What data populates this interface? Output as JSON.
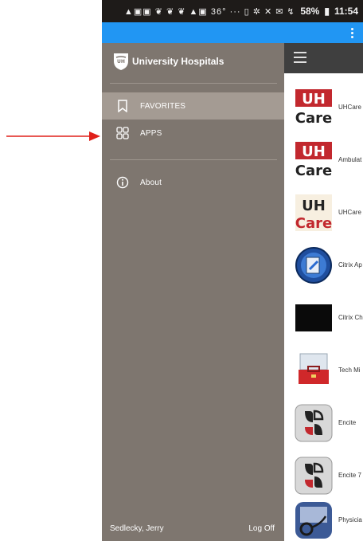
{
  "status_bar": {
    "icons_text": "▲▣▣ ❦ ❦ ❦ ▲▣ 36° ··· ▯ ✲ ✕ ✉ ↯",
    "battery": "58%",
    "time": "11:54"
  },
  "drawer": {
    "brand": "University Hospitals",
    "items": [
      {
        "label": "FAVORITES",
        "icon": "bookmark-icon"
      },
      {
        "label": "APPS",
        "icon": "grid-icon"
      },
      {
        "label": "About",
        "icon": "info-icon"
      }
    ],
    "footer_user": "Sedlecky, Jerry",
    "footer_logoff": "Log Off"
  },
  "apps": [
    {
      "label": "UHCare",
      "icon": "uh-care-red-icon"
    },
    {
      "label": "Ambulat",
      "icon": "uh-care-red-icon"
    },
    {
      "label": "UHCare",
      "icon": "uh-care-orange-icon"
    },
    {
      "label": "Citrix Ap",
      "icon": "citrix-icon"
    },
    {
      "label": "Citrix Ch",
      "icon": "black-tile-icon"
    },
    {
      "label": "Tech Mi",
      "icon": "toolbox-icon"
    },
    {
      "label": "Encite",
      "icon": "encite-icon"
    },
    {
      "label": "Encite 7",
      "icon": "encite-icon"
    },
    {
      "label": "Physicia",
      "icon": "physician-icon"
    }
  ],
  "colors": {
    "drawer_bg": "#7e766f",
    "active_bg": "#a49b93",
    "topbar": "#2196f3",
    "annotation": "#e0201a"
  }
}
